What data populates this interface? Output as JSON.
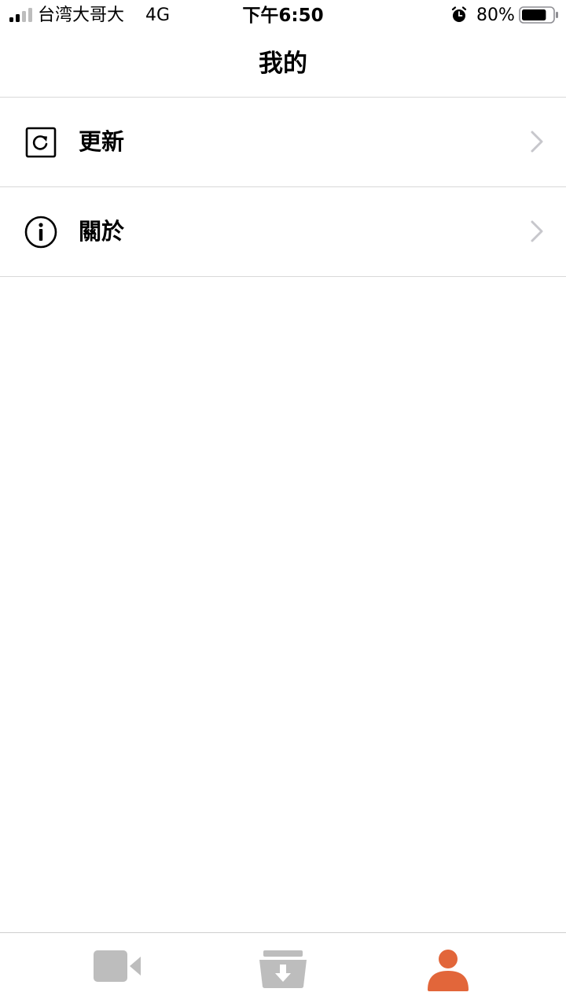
{
  "status_bar": {
    "carrier": "台湾大哥大",
    "network": "4G",
    "time": "下午6:50",
    "battery_percent": "80%",
    "battery_level": 0.8,
    "icons": [
      "signal-icon",
      "alarm-icon",
      "battery-icon"
    ]
  },
  "nav": {
    "title": "我的"
  },
  "menu": {
    "items": [
      {
        "label": "更新",
        "icon": "refresh-icon"
      },
      {
        "label": "關於",
        "icon": "info-icon"
      }
    ]
  },
  "tab_bar": {
    "tabs": [
      {
        "icon": "video-camera-icon",
        "active": false
      },
      {
        "icon": "download-box-icon",
        "active": false
      },
      {
        "icon": "person-icon",
        "active": true
      }
    ]
  },
  "colors": {
    "accent": "#e2663a",
    "inactive": "#bdbdbd",
    "chevron": "#c7c7cc",
    "divider": "#d9d9d9"
  }
}
